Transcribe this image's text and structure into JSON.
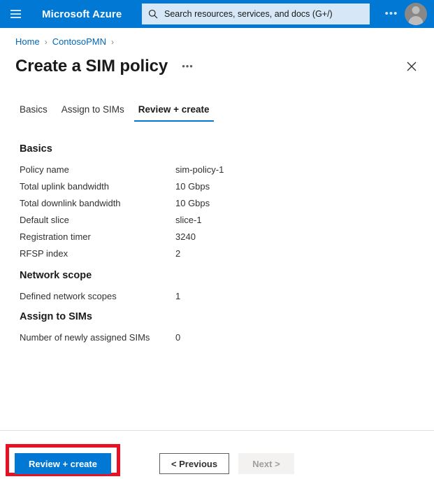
{
  "topbar": {
    "menu_icon": "hamburger-icon",
    "brand": "Microsoft Azure",
    "search": {
      "icon": "search-icon",
      "placeholder": "Search resources, services, and docs (G+/)",
      "value": ""
    },
    "more_label": "•••",
    "avatar_icon": "user-avatar-icon",
    "background_color": "#0078d4"
  },
  "breadcrumb": {
    "items": [
      {
        "label": "Home"
      },
      {
        "label": "ContosoPMN"
      }
    ],
    "separator": "›",
    "link_color": "#0067b8"
  },
  "header": {
    "title": "Create a SIM policy",
    "more_label": "•••",
    "close_icon": "close-icon"
  },
  "tabs": [
    {
      "label": "Basics",
      "active": false
    },
    {
      "label": "Assign to SIMs",
      "active": false
    },
    {
      "label": "Review + create",
      "active": true
    }
  ],
  "main": {
    "sections": [
      {
        "heading": "Basics",
        "rows": [
          {
            "label": "Policy name",
            "value": "sim-policy-1"
          },
          {
            "label": "Total uplink bandwidth",
            "value": "10 Gbps"
          },
          {
            "label": "Total downlink bandwidth",
            "value": "10 Gbps"
          },
          {
            "label": "Default slice",
            "value": "slice-1"
          },
          {
            "label": "Registration timer",
            "value": "3240"
          },
          {
            "label": "RFSP index",
            "value": "2"
          }
        ]
      },
      {
        "heading": "Network scope",
        "rows": [
          {
            "label": "Defined network scopes",
            "value": "1"
          }
        ]
      },
      {
        "heading": "Assign to SIMs",
        "rows": [
          {
            "label": "Number of newly assigned SIMs",
            "value": "0"
          }
        ]
      }
    ]
  },
  "footer": {
    "primary_button": "Review + create",
    "previous_button": "< Previous",
    "next_button": "Next >",
    "next_disabled": true,
    "highlight_color": "#e81123",
    "accent_color": "#0078d4"
  }
}
